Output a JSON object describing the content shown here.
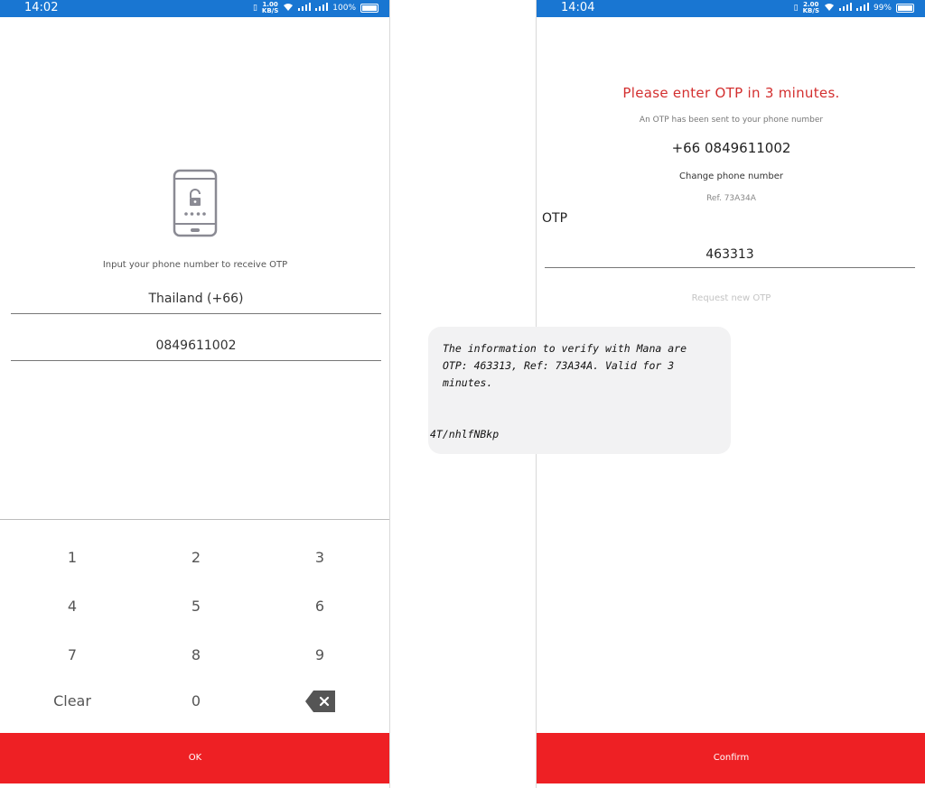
{
  "left": {
    "status_time": "14:02",
    "status_netspeed_value": "1.00",
    "status_netspeed_unit": "KB/S",
    "status_battery": "100%",
    "prompt": "Input your phone number to receive OTP",
    "country": "Thailand (+66)",
    "phone": "0849611002",
    "keypad": {
      "k1": "1",
      "k2": "2",
      "k3": "3",
      "k4": "4",
      "k5": "5",
      "k6": "6",
      "k7": "7",
      "k8": "8",
      "k9": "9",
      "clear": "Clear",
      "k0": "0"
    },
    "ok_label": "OK"
  },
  "right": {
    "status_time": "14:04",
    "status_netspeed_value": "2.00",
    "status_netspeed_unit": "KB/S",
    "status_battery": "99%",
    "title": "Please enter OTP in 3 minutes.",
    "sent_text": "An OTP has been sent to your phone number",
    "phone": "+66 0849611002",
    "change_phone": "Change phone number",
    "ref": "Ref. 73A34A",
    "otp_label": "OTP",
    "otp_value": "463313",
    "request_new": "Request new OTP",
    "confirm_label": "Confirm"
  },
  "sms": {
    "message": "The information to verify with Mana are OTP: 463313, Ref: 73A34A. Valid for 3 minutes.",
    "code": "4T/nhlfNBkp"
  },
  "colors": {
    "status_bar": "#1976d2",
    "accent_red": "#ee2024",
    "title_red": "#d32f2f"
  }
}
